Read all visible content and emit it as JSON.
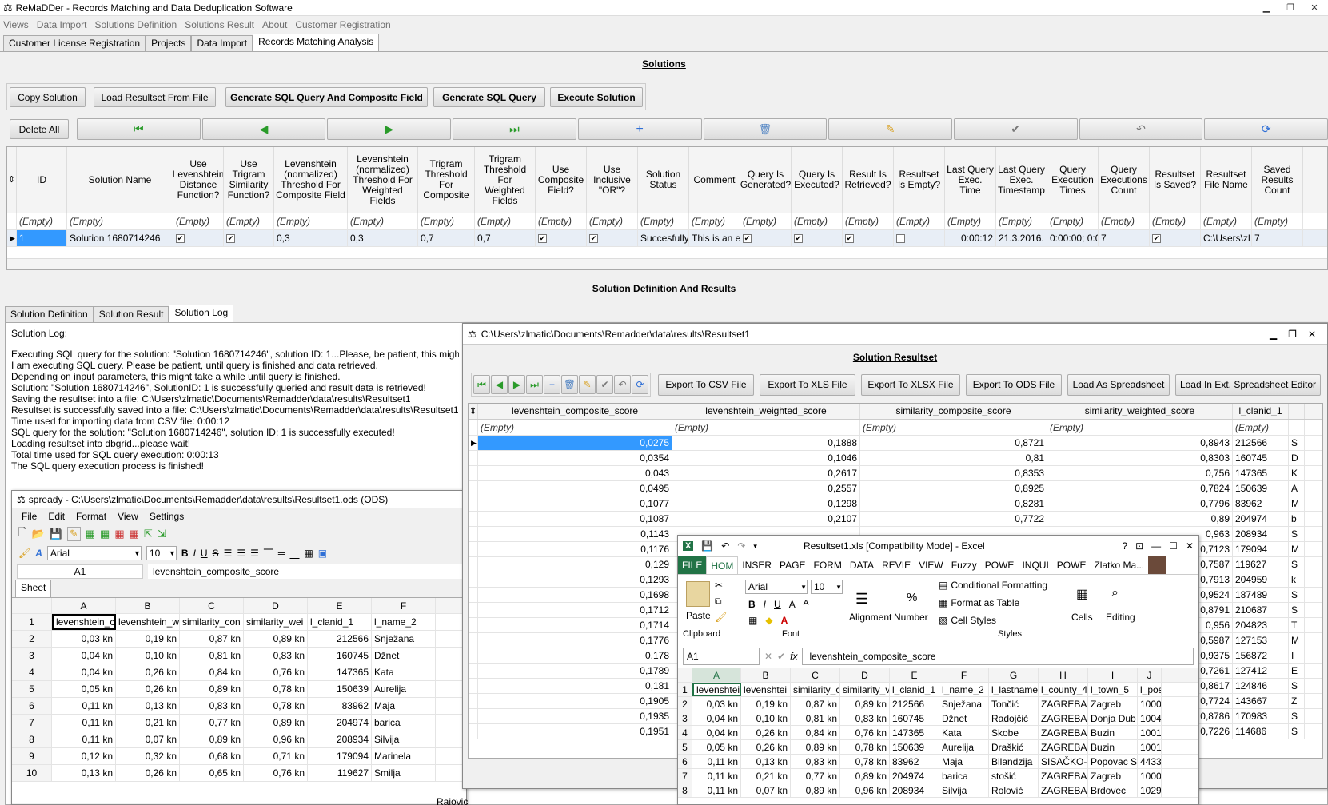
{
  "app": {
    "title": "ReMaDDer - Records Matching and Data Deduplication Software"
  },
  "menu": [
    "Views",
    "Data Import",
    "Solutions Definition",
    "Solutions Result",
    "About",
    "Customer Registration"
  ],
  "main_tabs": [
    "Customer License Registration",
    "Projects",
    "Data Import",
    "Records Matching Analysis"
  ],
  "solutions": {
    "title": "Solutions",
    "buttons": {
      "copy": "Copy Solution",
      "load": "Load Resultset From File",
      "gen_sql_comp": "Generate SQL Query And Composite Field",
      "gen_sql": "Generate SQL Query",
      "execute": "Execute Solution",
      "delete_all": "Delete All"
    },
    "nav_icons": [
      "first-icon",
      "prior-icon",
      "next-icon",
      "last-icon",
      "insert-icon",
      "delete-icon",
      "edit-icon",
      "post-icon",
      "cancel-icon",
      "refresh-icon"
    ],
    "columns": [
      "ID",
      "Solution Name",
      "Use Levenshtein Distance Function?",
      "Use Trigram Similarity Function?",
      "Levenshtein (normalized) Threshold For Composite Field",
      "Levenshtein (normalized) Threshold For Weighted Fields",
      "Trigram Threshold For Composite",
      "Trigram Threshold For Weighted Fields",
      "Use Composite Field?",
      "Use Inclusive \"OR\"?",
      "Solution Status",
      "Comment",
      "Query Is Generated?",
      "Query Is Executed?",
      "Result Is Retrieved?",
      "Resultset Is Empty?",
      "Last Query Exec. Time",
      "Last Query Exec. Timestamp",
      "Query Execution Times",
      "Query Executions Count",
      "Resultset Is Saved?",
      "Resultset File Name",
      "Saved Results Count"
    ],
    "filter": "(Empty)",
    "row": {
      "id": "1",
      "name": "Solution 1680714246",
      "lev_comp": "0,3",
      "lev_w": "0,3",
      "tri_comp": "0,7",
      "tri_w": "0,7",
      "status": "Succesfully",
      "comment": "This is an e",
      "exec_time": "0:00:12",
      "timestamp": "21.3.2016. 1",
      "exec_times": "0:00:00; 0:0",
      "exec_count": "7",
      "file": "C:\\Users\\zl",
      "saved_count": "7"
    }
  },
  "definition": {
    "title": "Solution Definition And Results",
    "tabs": [
      "Solution Definition",
      "Solution Result",
      "Solution Log"
    ]
  },
  "log": {
    "header": "Solution Log:",
    "lines": [
      "Executing SQL query for the solution: \"Solution 1680714246\", solution ID: 1...Please, be patient, this might ta",
      "I am executing SQL query. Please be patient, until query is finished and data retrieved.",
      "Depending on input parameters, this might take a while until query is finished.",
      "Solution: \"Solution 1680714246\", SolutionID: 1 is successfully queried and result data is retrieved!",
      "Saving the resultset into a file: C:\\Users\\zlmatic\\Documents\\Remadder\\data\\results\\Resultset1",
      "Resultset is successfully saved into a file: C:\\Users\\zlmatic\\Documents\\Remadder\\data\\results\\Resultset1",
      "Time used for importing data from CSV file: 0:00:12",
      "SQL query for the solution: \"Solution 1680714246\", solution ID: 1 is successfully executed!",
      "Loading resultset into dbgrid...please wait!",
      "Total time used for SQL query execution: 0:00:13",
      "The SQL query execution process is finished!"
    ]
  },
  "resultset": {
    "title": "C:\\Users\\zlmatic\\Documents\\Remadder\\data\\results\\Resultset1",
    "heading": "Solution Resultset",
    "buttons": [
      "Export To CSV File",
      "Export To XLS File",
      "Export To XLSX File",
      "Export To ODS File",
      "Load As Spreadsheet",
      "Load In Ext. Spreadsheet Editor"
    ],
    "columns": [
      "levenshtein_composite_score",
      "levenshtein_weighted_score",
      "similarity_composite_score",
      "similarity_weighted_score",
      "l_clanid_1"
    ],
    "filter": "(Empty)",
    "rows": [
      [
        "0,0275",
        "0,1888",
        "0,8721",
        "0,8943",
        "212566",
        "S"
      ],
      [
        "0,0354",
        "0,1046",
        "0,81",
        "0,8303",
        "160745",
        "D"
      ],
      [
        "0,043",
        "0,2617",
        "0,8353",
        "0,756",
        "147365",
        "K"
      ],
      [
        "0,0495",
        "0,2557",
        "0,8925",
        "0,7824",
        "150639",
        "A"
      ],
      [
        "0,1077",
        "0,1298",
        "0,8281",
        "0,7796",
        "83962",
        "M"
      ],
      [
        "0,1087",
        "0,2107",
        "0,7722",
        "0,89",
        "204974",
        "b"
      ],
      [
        "0,1143",
        "",
        "",
        "0,963",
        "208934",
        "S"
      ],
      [
        "0,1176",
        "",
        "",
        "0,7123",
        "179094",
        "M"
      ],
      [
        "0,129",
        "",
        "",
        "0,7587",
        "119627",
        "S"
      ],
      [
        "0,1293",
        "",
        "",
        "0,7913",
        "204959",
        "k"
      ],
      [
        "0,1698",
        "",
        "",
        "0,9524",
        "187489",
        "S"
      ],
      [
        "0,1712",
        "",
        "",
        "0,8791",
        "210687",
        "S"
      ],
      [
        "0,1714",
        "",
        "",
        "0,956",
        "204823",
        "T"
      ],
      [
        "0,1776",
        "",
        "",
        "0,5987",
        "127153",
        "M"
      ],
      [
        "0,178",
        "",
        "",
        "0,9375",
        "156872",
        "I"
      ],
      [
        "0,1789",
        "",
        "",
        "0,7261",
        "127412",
        "E"
      ],
      [
        "0,181",
        "",
        "",
        "0,8617",
        "124846",
        "S"
      ],
      [
        "0,1905",
        "",
        "",
        "0,7724",
        "143667",
        "Z"
      ],
      [
        "0,1935",
        "",
        "",
        "0,8786",
        "170983",
        "S"
      ],
      [
        "0,1951",
        "",
        "",
        "0,7226",
        "114686",
        "S"
      ]
    ]
  },
  "spready": {
    "title": "spready - C:\\Users\\zlmatic\\Documents\\Remadder\\data\\results\\Resultset1.ods (ODS)",
    "menu": [
      "File",
      "Edit",
      "Format",
      "View",
      "Settings"
    ],
    "font": "Arial",
    "size": "10",
    "cell": "A1",
    "formula": "levenshtein_composite_score",
    "sheet": "Sheet",
    "cols": [
      "A",
      "B",
      "C",
      "D",
      "E",
      "F"
    ],
    "rows": [
      [
        "levenshtein_c",
        "levenshtein_w",
        "similarity_con",
        "similarity_wei",
        "l_clanid_1",
        "l_name_2"
      ],
      [
        "0,03 kn",
        "0,19 kn",
        "0,87 kn",
        "0,89 kn",
        "212566",
        "Snježana"
      ],
      [
        "0,04 kn",
        "0,10 kn",
        "0,81 kn",
        "0,83 kn",
        "160745",
        "Džnet"
      ],
      [
        "0,04 kn",
        "0,26 kn",
        "0,84 kn",
        "0,76 kn",
        "147365",
        "Kata"
      ],
      [
        "0,05 kn",
        "0,26 kn",
        "0,89 kn",
        "0,78 kn",
        "150639",
        "Aurelija"
      ],
      [
        "0,11 kn",
        "0,13 kn",
        "0,83 kn",
        "0,78 kn",
        "83962",
        "Maja"
      ],
      [
        "0,11 kn",
        "0,21 kn",
        "0,77 kn",
        "0,89 kn",
        "204974",
        "barica"
      ],
      [
        "0,11 kn",
        "0,07 kn",
        "0,89 kn",
        "0,96 kn",
        "208934",
        "Silvija"
      ],
      [
        "0,12 kn",
        "0,32 kn",
        "0,68 kn",
        "0,71 kn",
        "179094",
        "Marinela"
      ],
      [
        "0,13 kn",
        "0,26 kn",
        "0,65 kn",
        "0,76 kn",
        "119627",
        "Smilja"
      ]
    ],
    "extra": "Rajovic"
  },
  "excel": {
    "title": "Resultset1.xls [Compatibility Mode] - Excel",
    "tabs": [
      "FILE",
      "HOM",
      "INSER",
      "PAGE",
      "FORM",
      "DATA",
      "REVIE",
      "VIEW",
      "Fuzzy",
      "POWE",
      "INQUI",
      "POWE"
    ],
    "user": "Zlatko Ma...",
    "paste": "Paste",
    "clipboard": "Clipboard",
    "font": "Arial",
    "size": "10",
    "font_group": "Font",
    "alignment": "Alignment",
    "number": "Number",
    "cond": "Conditional Formatting",
    "fmt_table": "Format as Table",
    "cell_styles": "Cell Styles",
    "styles": "Styles",
    "cells": "Cells",
    "editing": "Editing",
    "namebox": "A1",
    "formula": "levenshtein_composite_score",
    "cols": [
      "A",
      "B",
      "C",
      "D",
      "E",
      "F",
      "G",
      "H",
      "I",
      "J"
    ],
    "rows": [
      [
        "levenshtei",
        "levenshtei",
        "similarity_c",
        "similarity_v",
        "l_clanid_1",
        "l_name_2",
        "l_lastname",
        "l_county_4",
        "l_town_5",
        "l_pos"
      ],
      [
        "0,03 kn",
        "0,19 kn",
        "0,87 kn",
        "0,89 kn",
        "212566",
        "Snježana",
        "Tončić",
        "ZAGREBA",
        "Zagreb",
        "1000"
      ],
      [
        "0,04 kn",
        "0,10 kn",
        "0,81 kn",
        "0,83 kn",
        "160745",
        "Džnet",
        "Radojčić",
        "ZAGREBA",
        "Donja Dub",
        "1004"
      ],
      [
        "0,04 kn",
        "0,26 kn",
        "0,84 kn",
        "0,76 kn",
        "147365",
        "Kata",
        "Skobe",
        "ZAGREBA",
        "Buzin",
        "1001"
      ],
      [
        "0,05 kn",
        "0,26 kn",
        "0,89 kn",
        "0,78 kn",
        "150639",
        "Aurelija",
        "Draškić",
        "ZAGREBA",
        "Buzin",
        "1001"
      ],
      [
        "0,11 kn",
        "0,13 kn",
        "0,83 kn",
        "0,78 kn",
        "83962",
        "Maja",
        "Bilandzija",
        "SISAČKO-",
        "Popovac S",
        "4433"
      ],
      [
        "0,11 kn",
        "0,21 kn",
        "0,77 kn",
        "0,89 kn",
        "204974",
        "barica",
        "stošić",
        "ZAGREBA",
        "Zagreb",
        "1000"
      ],
      [
        "0,11 kn",
        "0,07 kn",
        "0,89 kn",
        "0,96 kn",
        "208934",
        "Silvija",
        "Rolović",
        "ZAGREBA",
        "Brdovec",
        "1029"
      ]
    ]
  }
}
